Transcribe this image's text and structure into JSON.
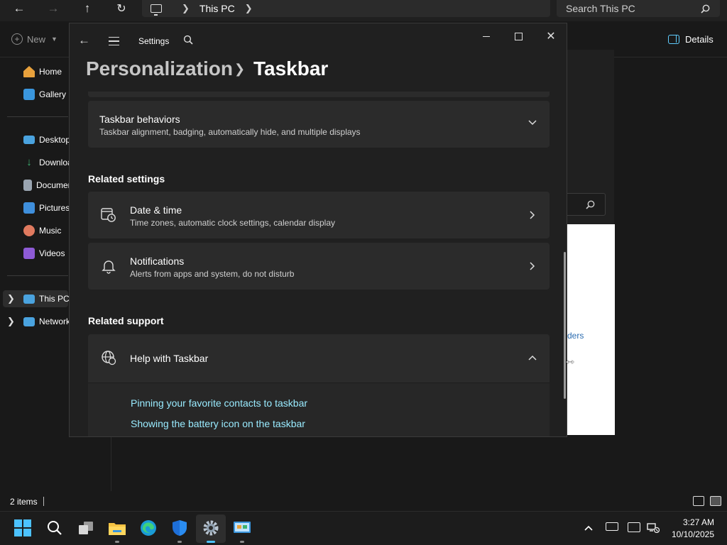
{
  "explorer": {
    "address": {
      "location": "This PC"
    },
    "search_placeholder": "Search This PC",
    "cmd": {
      "new_label": "New",
      "details_label": "Details"
    },
    "nav_items": [
      {
        "label": "Home",
        "color": "#e8a13c"
      },
      {
        "label": "Gallery",
        "color": "#3a96dd"
      },
      {
        "label": "Desktop",
        "color": "#4aa3df"
      },
      {
        "label": "Downloads",
        "color": "#3cb371"
      },
      {
        "label": "Documents",
        "color": "#9aa5b1"
      },
      {
        "label": "Pictures",
        "color": "#3f8fdc"
      },
      {
        "label": "Music",
        "color": "#e07a5f"
      },
      {
        "label": "Videos",
        "color": "#8e5bd6"
      },
      {
        "label": "This PC",
        "color": "#4aa3df"
      },
      {
        "label": "Network",
        "color": "#4aa3df"
      }
    ],
    "right_panel_link": "ders",
    "status": {
      "items": "2 items"
    }
  },
  "settings": {
    "app_title": "Settings",
    "breadcrumb": {
      "parent": "Personalization",
      "current": "Taskbar"
    },
    "taskbar_behaviors": {
      "title": "Taskbar behaviors",
      "subtitle": "Taskbar alignment, badging, automatically hide, and multiple displays"
    },
    "related_settings": {
      "heading": "Related settings",
      "items": [
        {
          "title": "Date & time",
          "subtitle": "Time zones, automatic clock settings, calendar display"
        },
        {
          "title": "Notifications",
          "subtitle": "Alerts from apps and system, do not disturb"
        }
      ]
    },
    "related_support": {
      "heading": "Related support",
      "help_title": "Help with Taskbar",
      "links": [
        "Pinning your favorite contacts to taskbar",
        "Showing the battery icon on the taskbar"
      ]
    }
  },
  "taskbar": {
    "clock": {
      "time": "3:27 AM",
      "date": "10/10/2025"
    }
  },
  "colors": {
    "accent": "#60cdff",
    "link": "#99ebff",
    "start": "#4cc2ff"
  }
}
